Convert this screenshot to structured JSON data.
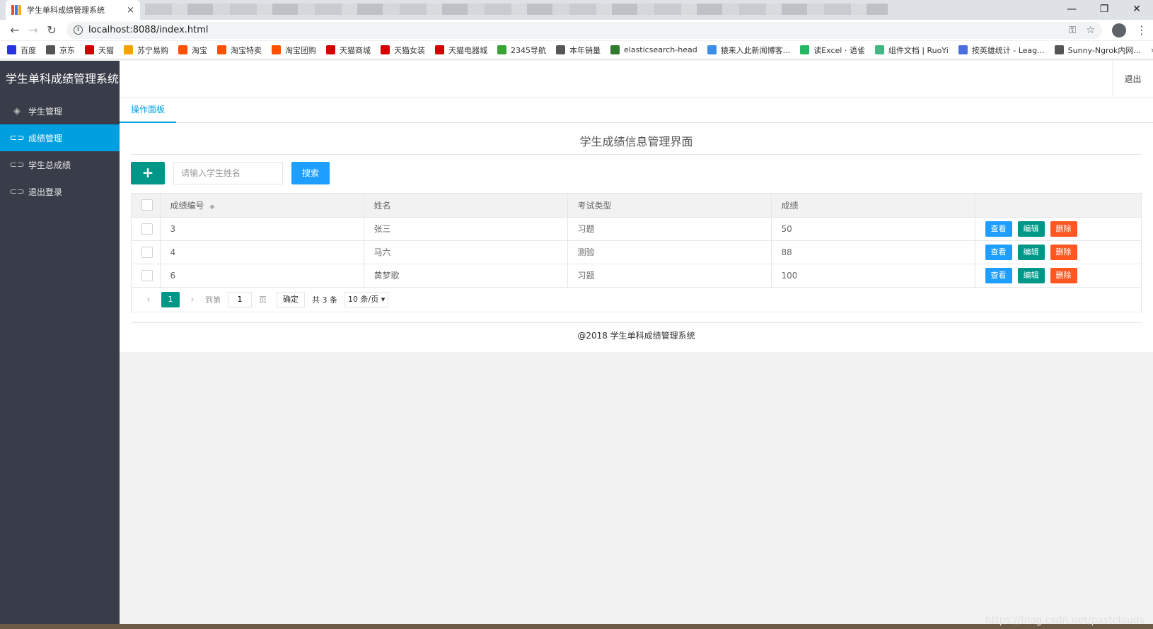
{
  "browser": {
    "tab_title": "学生单科成绩管理系统",
    "tab_close": "×",
    "url": "localhost:8088/index.html",
    "window_controls": [
      "—",
      "❐",
      "✕"
    ],
    "bookmarks": [
      {
        "label": "百度",
        "color": "#2932e1"
      },
      {
        "label": "京东",
        "color": "#555555"
      },
      {
        "label": "天猫",
        "color": "#d40000"
      },
      {
        "label": "苏宁易购",
        "color": "#f5a300"
      },
      {
        "label": "淘宝",
        "color": "#ff5000"
      },
      {
        "label": "淘宝特卖",
        "color": "#ff5000"
      },
      {
        "label": "淘宝团购",
        "color": "#ff5000"
      },
      {
        "label": "天猫商城",
        "color": "#d40000"
      },
      {
        "label": "天猫女装",
        "color": "#d40000"
      },
      {
        "label": "天猫电器城",
        "color": "#d40000"
      },
      {
        "label": "2345导航",
        "color": "#3aa335"
      },
      {
        "label": "本年销量",
        "color": "#555555"
      },
      {
        "label": "elasticsearch-head",
        "color": "#2f7a2f"
      },
      {
        "label": "猿来入此新闻博客...",
        "color": "#3a8ee6"
      },
      {
        "label": "读Excel · 语雀",
        "color": "#25b864"
      },
      {
        "label": "组件文档 | RuoYi",
        "color": "#41b883"
      },
      {
        "label": "按英雄统计 - Leag...",
        "color": "#4a6ee0"
      },
      {
        "label": "Sunny-Ngrok内网...",
        "color": "#555555"
      }
    ],
    "bookmarks_more": "»"
  },
  "app": {
    "logo": "学生单科成绩管理系统",
    "logout_top": "退出",
    "nav": [
      {
        "label": "学生管理",
        "icon": "layers-icon",
        "glyph": "◈",
        "active": false
      },
      {
        "label": "成绩管理",
        "icon": "link-icon",
        "glyph": "⊂⊃",
        "active": true
      },
      {
        "label": "学生总成绩",
        "icon": "link-icon",
        "glyph": "⊂⊃",
        "active": false
      },
      {
        "label": "退出登录",
        "icon": "unlink-icon",
        "glyph": "⊂⊃",
        "active": false
      }
    ],
    "tab": "操作面板",
    "page_title": "学生成绩信息管理界面",
    "add_label": "+",
    "search_placeholder": "请输入学生姓名",
    "search_label": "搜索",
    "table": {
      "columns": [
        "成绩编号",
        "姓名",
        "考试类型",
        "成绩"
      ],
      "sort_glyph": "◆",
      "rows": [
        {
          "id": "3",
          "name": "张三",
          "type": "习题",
          "score": "50"
        },
        {
          "id": "4",
          "name": "马六",
          "type": "测验",
          "score": "88"
        },
        {
          "id": "6",
          "name": "黄梦歌",
          "type": "习题",
          "score": "100"
        }
      ],
      "actions": {
        "view": "查看",
        "edit": "编辑",
        "delete": "删除"
      }
    },
    "pager": {
      "prev": "‹",
      "current": "1",
      "next": "›",
      "goto_prefix": "到第",
      "goto_value": "1",
      "goto_suffix": "页",
      "confirm": "确定",
      "total": "共 3 条",
      "page_size": "10 条/页 ▾"
    },
    "footer": "@2018 学生单科成绩管理系统"
  },
  "watermark": "https://blog.csdn.net/pastclouds",
  "colors": {
    "sidebar": "#393d49",
    "active": "#009fe0",
    "green": "#009688",
    "blue": "#1e9fff",
    "red": "#ff5722"
  }
}
